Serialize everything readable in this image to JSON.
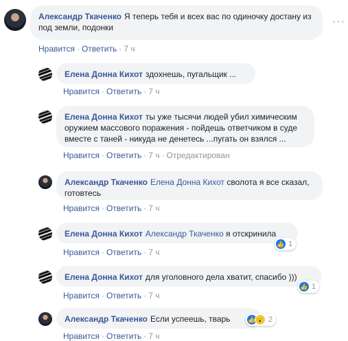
{
  "comments": [
    {
      "author": "Александр Ткаченко",
      "mention": "",
      "text": "Я теперь тебя и всех вас по одиночку достану из под земли, подонки",
      "like": "Нравится",
      "reply": "Ответить",
      "time": "7 ч",
      "edited": "",
      "reaction_count": ""
    },
    {
      "author": "Елена Донна Кихот",
      "mention": "",
      "text": "здохнешь, пугальщик ...",
      "like": "Нравится",
      "reply": "Ответить",
      "time": "7 ч",
      "edited": "",
      "reaction_count": ""
    },
    {
      "author": "Елена Донна Кихот",
      "mention": "",
      "text": "ты уже тысячи людей убил химическим оружием массового поражения - пойдешь ответчиком в суде вместе с таней - никуда не денетесь ...пугать он взялся ...",
      "like": "Нравится",
      "reply": "Ответить",
      "time": "7 ч",
      "edited": "Отредактирован",
      "reaction_count": ""
    },
    {
      "author": "Александр Ткаченко",
      "mention": "Елена Донна Кихот",
      "text": "сволота я все сказал, готовтесь",
      "like": "Нравится",
      "reply": "Ответить",
      "time": "7 ч",
      "edited": "",
      "reaction_count": ""
    },
    {
      "author": "Елена Донна Кихот",
      "mention": "Александр Ткаченко",
      "text": "я отскринила",
      "like": "Нравится",
      "reply": "Ответить",
      "time": "7 ч",
      "edited": "",
      "reaction_count": "1"
    },
    {
      "author": "Елена Донна Кихот",
      "mention": "",
      "text": "для уголовного дела хватит, спасибо )))",
      "like": "Нравится",
      "reply": "Ответить",
      "time": "7 ч",
      "edited": "",
      "reaction_count": "1"
    },
    {
      "author": "Александр Ткаченко",
      "mention": "",
      "text": "Если успеешь, тварь",
      "like": "Нравится",
      "reply": "Ответить",
      "time": "7 ч",
      "edited": "",
      "reaction_count": "2"
    }
  ],
  "separator": "·",
  "more_glyph": "···",
  "colors": {
    "link": "#385898",
    "bubble": "#f2f3f5",
    "meta": "#90949c",
    "like": "#1877f2"
  },
  "icons": {
    "like": "thumbs-up-icon",
    "wow": "wow-face-icon",
    "more": "more-options-icon"
  }
}
